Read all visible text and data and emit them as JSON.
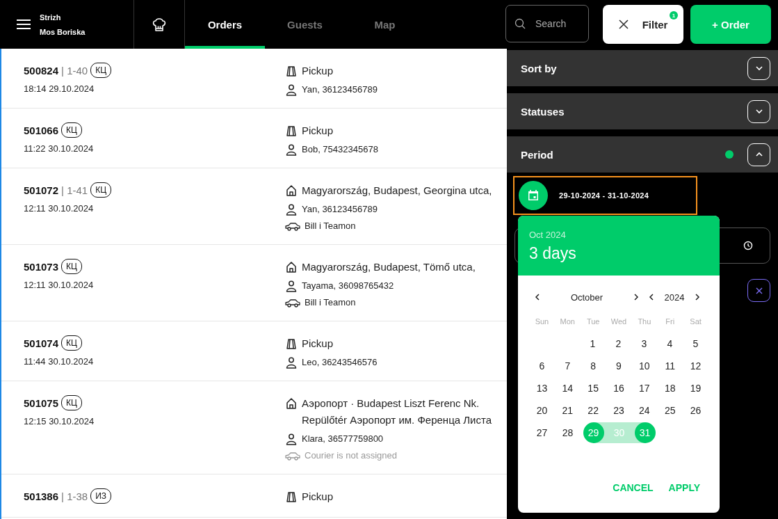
{
  "header": {
    "brand": {
      "line_1": "Strizh",
      "line_2": "Mos Boriska"
    },
    "tabs": [
      {
        "label": "Orders",
        "selected": true
      },
      {
        "label": "Guests",
        "selected": false
      },
      {
        "label": "Map",
        "selected": false
      }
    ],
    "search": {
      "placeholder": "Search"
    },
    "filter_button": {
      "label": "Filter",
      "badge": "1"
    },
    "order_button": {
      "label": "+ Order"
    }
  },
  "orders": [
    {
      "number": "500824",
      "slot": "| 1-40",
      "tag": "КЦ",
      "time": "18:14 29.10.2024",
      "lines": [
        {
          "kind": "pickup",
          "text": "Pickup"
        },
        {
          "kind": "guest",
          "text": "Yan, 36123456789"
        }
      ]
    },
    {
      "number": "501066",
      "tag": "КЦ",
      "time": "11:22 30.10.2024",
      "lines": [
        {
          "kind": "pickup",
          "text": "Pickup"
        },
        {
          "kind": "guest",
          "text": "Bob, 75432345678"
        }
      ]
    },
    {
      "number": "501072",
      "slot": "| 1-41",
      "tag": "КЦ",
      "time": "12:11 30.10.2024",
      "lines": [
        {
          "kind": "address",
          "text": "Magyarország, Budapest, Georgina utca,"
        },
        {
          "kind": "guest",
          "text": "Yan, 36123456789"
        },
        {
          "kind": "courier",
          "text": "Bill i Teamon",
          "assigned": true
        }
      ]
    },
    {
      "number": "501073",
      "tag": "КЦ",
      "time": "12:11 30.10.2024",
      "lines": [
        {
          "kind": "address",
          "text": "Magyarország, Budapest, Tömő utca,"
        },
        {
          "kind": "guest",
          "text": "Tayama, 36098765432"
        },
        {
          "kind": "courier",
          "text": "Bill i Teamon",
          "assigned": true
        }
      ]
    },
    {
      "number": "501074",
      "tag": "КЦ",
      "time": "11:44 30.10.2024",
      "lines": [
        {
          "kind": "pickup",
          "text": "Pickup"
        },
        {
          "kind": "guest",
          "text": "Leo, 36243546576"
        }
      ]
    },
    {
      "number": "501075",
      "tag": "КЦ",
      "time": "12:15 30.10.2024",
      "lines": [
        {
          "kind": "address",
          "text": "Аэропорт · Budapest Liszt Ferenc Nk. Repülőtér Аэропорт им. Ференца Листа"
        },
        {
          "kind": "guest",
          "text": "Klara, 36577759800"
        },
        {
          "kind": "courier",
          "text": "Courier is not assigned",
          "assigned": false
        }
      ]
    },
    {
      "number": "501386",
      "slot": "| 1-38",
      "tag": "ИЗ",
      "lines": [
        {
          "kind": "pickup",
          "text": "Pickup"
        }
      ]
    }
  ],
  "filter_panel": {
    "sections": [
      {
        "title": "Sort by",
        "expanded": false,
        "active": false
      },
      {
        "title": "Statuses",
        "expanded": false,
        "active": false
      },
      {
        "title": "Period",
        "expanded": true,
        "active": true
      }
    ],
    "period_field": {
      "value": "29-10-2024 - 31-10-2024"
    }
  },
  "date_picker": {
    "header_month": "Oct 2024",
    "header_range": "3 days",
    "month": "October",
    "year": "2024",
    "weekdays": [
      "Sun",
      "Mon",
      "Tue",
      "Wed",
      "Thu",
      "Fri",
      "Sat"
    ],
    "weeks": [
      [
        {
          "day": "1",
          "selected": false,
          "in_range": false
        },
        {
          "day": "2",
          "selected": false,
          "in_range": false
        },
        {
          "day": "3",
          "selected": false,
          "in_range": false
        },
        {
          "day": "4",
          "selected": false,
          "in_range": false
        },
        {
          "day": "5",
          "selected": false,
          "in_range": false
        }
      ],
      [
        {
          "day": "6",
          "selected": false,
          "in_range": false
        },
        {
          "day": "7",
          "selected": false,
          "in_range": false
        },
        {
          "day": "8",
          "selected": false,
          "in_range": false
        },
        {
          "day": "9",
          "selected": false,
          "in_range": false
        },
        {
          "day": "10",
          "selected": false,
          "in_range": false
        },
        {
          "day": "11",
          "selected": false,
          "in_range": false
        },
        {
          "day": "12",
          "selected": false,
          "in_range": false
        }
      ],
      [
        {
          "day": "13",
          "selected": false,
          "in_range": false
        },
        {
          "day": "14",
          "selected": false,
          "in_range": false
        },
        {
          "day": "15",
          "selected": false,
          "in_range": false
        },
        {
          "day": "16",
          "selected": false,
          "in_range": false
        },
        {
          "day": "17",
          "selected": false,
          "in_range": false
        },
        {
          "day": "18",
          "selected": false,
          "in_range": false
        },
        {
          "day": "19",
          "selected": false,
          "in_range": false
        }
      ],
      [
        {
          "day": "20",
          "selected": false,
          "in_range": false
        },
        {
          "day": "21",
          "selected": false,
          "in_range": false
        },
        {
          "day": "22",
          "selected": false,
          "in_range": false
        },
        {
          "day": "23",
          "selected": false,
          "in_range": false
        },
        {
          "day": "24",
          "selected": false,
          "in_range": false
        },
        {
          "day": "25",
          "selected": false,
          "in_range": false
        },
        {
          "day": "26",
          "selected": false,
          "in_range": false
        }
      ],
      [
        {
          "day": "27",
          "selected": false,
          "in_range": false
        },
        {
          "day": "28",
          "selected": false,
          "in_range": false
        },
        {
          "day": "29",
          "selected": true,
          "in_range": true
        },
        {
          "day": "30",
          "selected": false,
          "in_range": true
        },
        {
          "day": "31",
          "selected": true,
          "in_range": true
        }
      ]
    ],
    "buttons": [
      "CANCEL",
      "APPLY"
    ]
  }
}
